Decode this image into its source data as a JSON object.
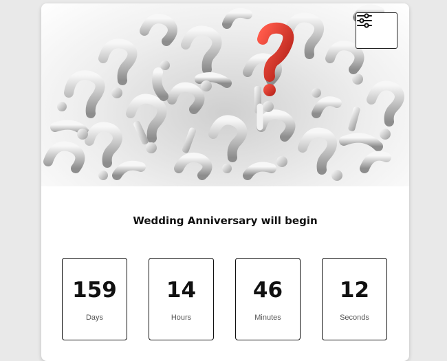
{
  "hero": {
    "image_subject": "pile of question marks with one red question mark",
    "accent_color": "#e0352b"
  },
  "settings_button": {
    "icon": "sliders-icon"
  },
  "event": {
    "title": "Wedding Anniversary will begin"
  },
  "countdown": [
    {
      "value": "159",
      "label": "Days"
    },
    {
      "value": "14",
      "label": "Hours"
    },
    {
      "value": "46",
      "label": "Minutes"
    },
    {
      "value": "12",
      "label": "Seconds"
    }
  ]
}
